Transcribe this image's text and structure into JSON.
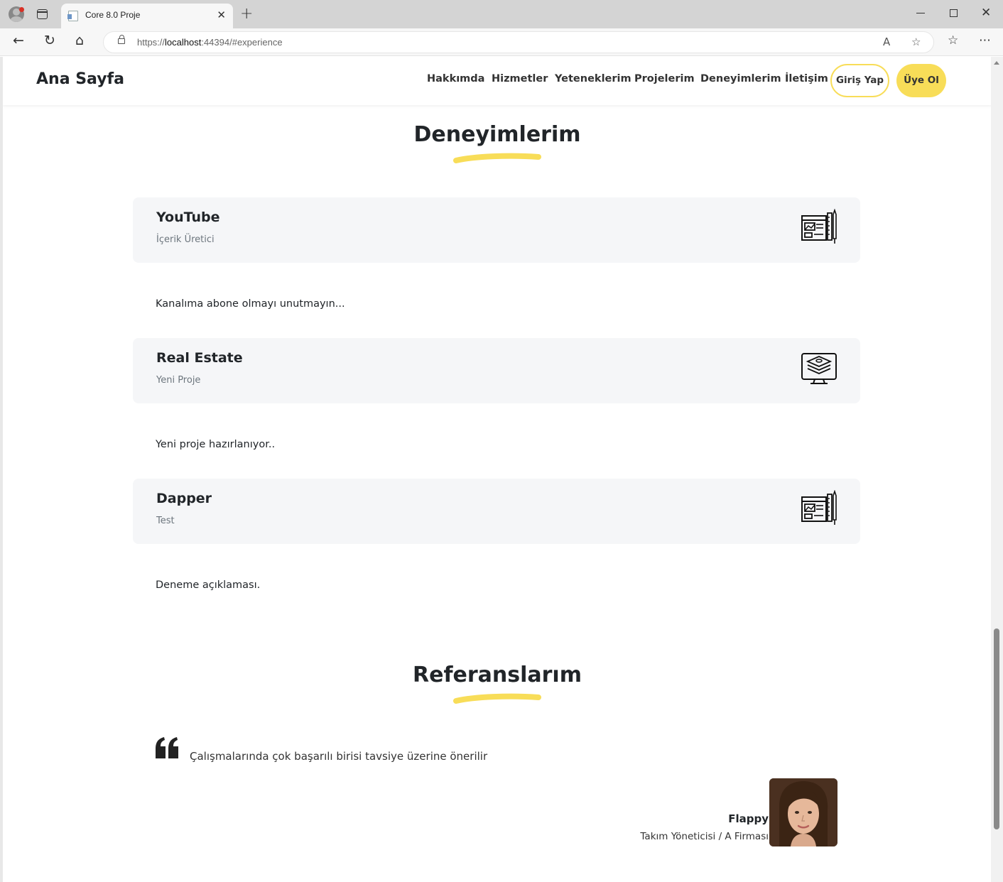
{
  "browser": {
    "tab_title": "Core 8.0 Proje",
    "url_prefix": "https://",
    "url_host": "localhost",
    "url_rest": ":44394/#experience",
    "tab_close": "✕",
    "new_tab": "+"
  },
  "nav": {
    "brand": "Ana Sayfa",
    "links": [
      "Hakkımda",
      "Hizmetler",
      "Yeteneklerim",
      "Projelerim",
      "Deneyimlerim",
      "İletişim"
    ],
    "login": "Giriş Yap",
    "register": "Üye Ol"
  },
  "experience": {
    "title": "Deneyimlerim",
    "items": [
      {
        "title": "YouTube",
        "subtitle": "İçerik Üretici",
        "description": "Kanalıma abone olmayı unutmayın...",
        "icon": "design-blueprint-icon"
      },
      {
        "title": "Real Estate",
        "subtitle": "Yeni Proje",
        "description": "Yeni proje hazırlanıyor..",
        "icon": "layers-monitor-icon"
      },
      {
        "title": "Dapper",
        "subtitle": "Test",
        "description": "Deneme açıklaması.",
        "icon": "design-blueprint-icon"
      }
    ]
  },
  "references": {
    "title": "Referanslarım",
    "quote": "Çalışmalarında çok başarılı birisi tavsiye üzerine önerilir",
    "name": "Flappy",
    "role": "Takım Yöneticisi / A Firması"
  },
  "colors": {
    "accent": "#f8dd58",
    "card_bg": "#f5f6f8",
    "text": "#212529",
    "muted": "#6c757d"
  }
}
